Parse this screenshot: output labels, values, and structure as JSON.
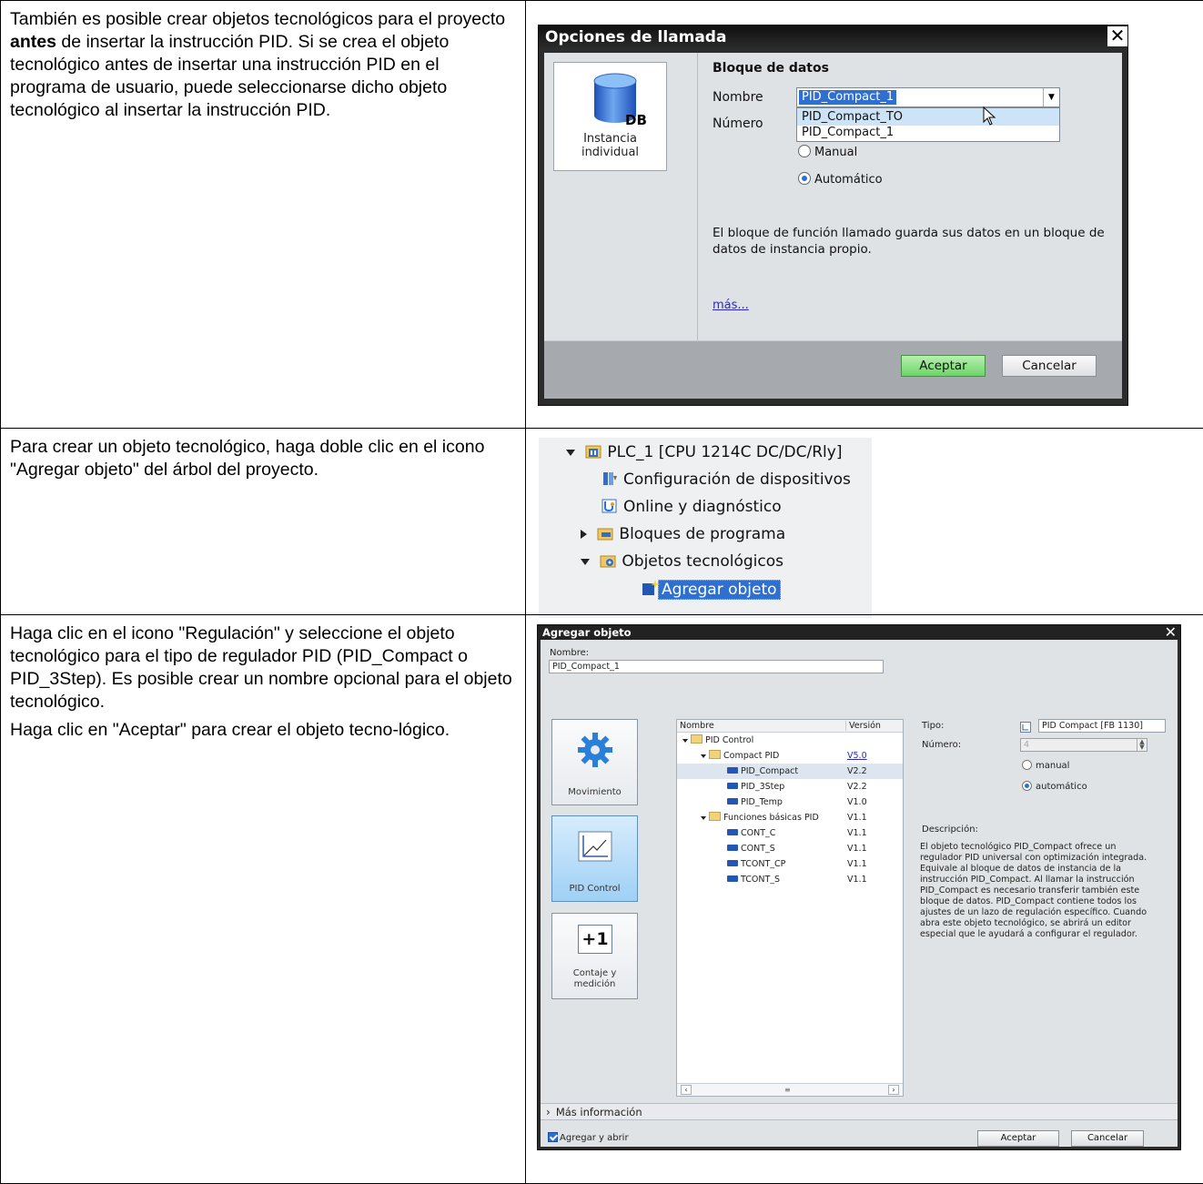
{
  "rows": [
    {
      "paragraphs": [
        {
          "before": "También es posible crear objetos tecnológicos para el proyecto ",
          "bold": "antes",
          "after": " de insertar la instrucción PID. Si se crea el objeto tecnológico antes de insertar una instrucción PID en el programa de usuario, puede seleccionarse dicho objeto tecnológico al insertar la instrucción PID."
        }
      ]
    },
    {
      "paragraphs": [
        {
          "text": "Para crear un objeto tecnológico, haga doble clic en el icono \"Agregar objeto\" del árbol del proyecto."
        }
      ]
    },
    {
      "paragraphs": [
        {
          "text": "Haga clic en el icono \"Regulación\" y seleccione el objeto tecnológico para el tipo de regulador PID (PID_Compact o PID_3Step). Es posible crear un nombre opcional para el objeto tecnológico."
        },
        {
          "text": "Haga clic en \"Aceptar\" para crear el objeto tecno-lógico."
        }
      ]
    }
  ],
  "call_options_dialog": {
    "title": "Opciones de llamada",
    "close": "✕",
    "tile_icon_text": "DB",
    "tile_label_line1": "Instancia",
    "tile_label_line2": "individual",
    "section_heading": "Bloque de datos",
    "name_label": "Nombre",
    "number_label": "Número",
    "name_value": "PID_Compact_1",
    "dropdown_options": [
      "PID_Compact_TO",
      "PID_Compact_1"
    ],
    "radio_manual": "Manual",
    "radio_auto": "Automático",
    "description": "El bloque de función llamado guarda sus datos en un bloque de datos de instancia propio.",
    "more_link": "más...",
    "ok": "Aceptar",
    "cancel": "Cancelar"
  },
  "project_tree": {
    "plc": "PLC_1 [CPU 1214C DC/DC/Rly]",
    "device_config": "Configuración de dispositivos",
    "online_diag": "Online y diagnóstico",
    "program_blocks": "Bloques de programa",
    "tech_objects": "Objetos tecnológicos",
    "add_object": "Agregar objeto"
  },
  "add_object_dialog": {
    "title": "Agregar objeto",
    "close": "✕",
    "name_label": "Nombre:",
    "name_value": "PID_Compact_1",
    "categories": {
      "motion": "Movimiento",
      "pid": "PID Control",
      "counting_l1": "Contaje y",
      "counting_l2": "medición",
      "counting_icon": "+1"
    },
    "col_name": "Nombre",
    "col_version": "Versión",
    "tree_rows": [
      {
        "name": "PID Control",
        "version": ""
      },
      {
        "name": "Compact PID",
        "version": "V5.0"
      },
      {
        "name": "PID_Compact",
        "version": "V2.2"
      },
      {
        "name": "PID_3Step",
        "version": "V2.2"
      },
      {
        "name": "PID_Temp",
        "version": "V1.0"
      },
      {
        "name": "Funciones básicas PID",
        "version": "V1.1"
      },
      {
        "name": "CONT_C",
        "version": "V1.1"
      },
      {
        "name": "CONT_S",
        "version": "V1.1"
      },
      {
        "name": "TCONT_CP",
        "version": "V1.1"
      },
      {
        "name": "TCONT_S",
        "version": "V1.1"
      }
    ],
    "type_label": "Tipo:",
    "type_value": "PID Compact [FB 1130]",
    "number_label": "Número:",
    "number_value": "4",
    "radio_manual": "manual",
    "radio_auto": "automático",
    "desc_label": "Descripción:",
    "description": "El objeto tecnológico PID_Compact ofrece un regulador PID universal con optimización integrada. Equivale al bloque de datos de instancia de la instrucción PID_Compact. Al llamar la instrucción PID_Compact es necesario transferir también este bloque de datos. PID_Compact contiene todos los ajustes de un lazo de regulación específico. Cuando abra este objeto tecnológico, se abrirá un editor especial que le ayudará a configurar el regulador.",
    "more_info": "Más información",
    "add_open": "Agregar y abrir",
    "ok": "Aceptar",
    "cancel": "Cancelar"
  }
}
